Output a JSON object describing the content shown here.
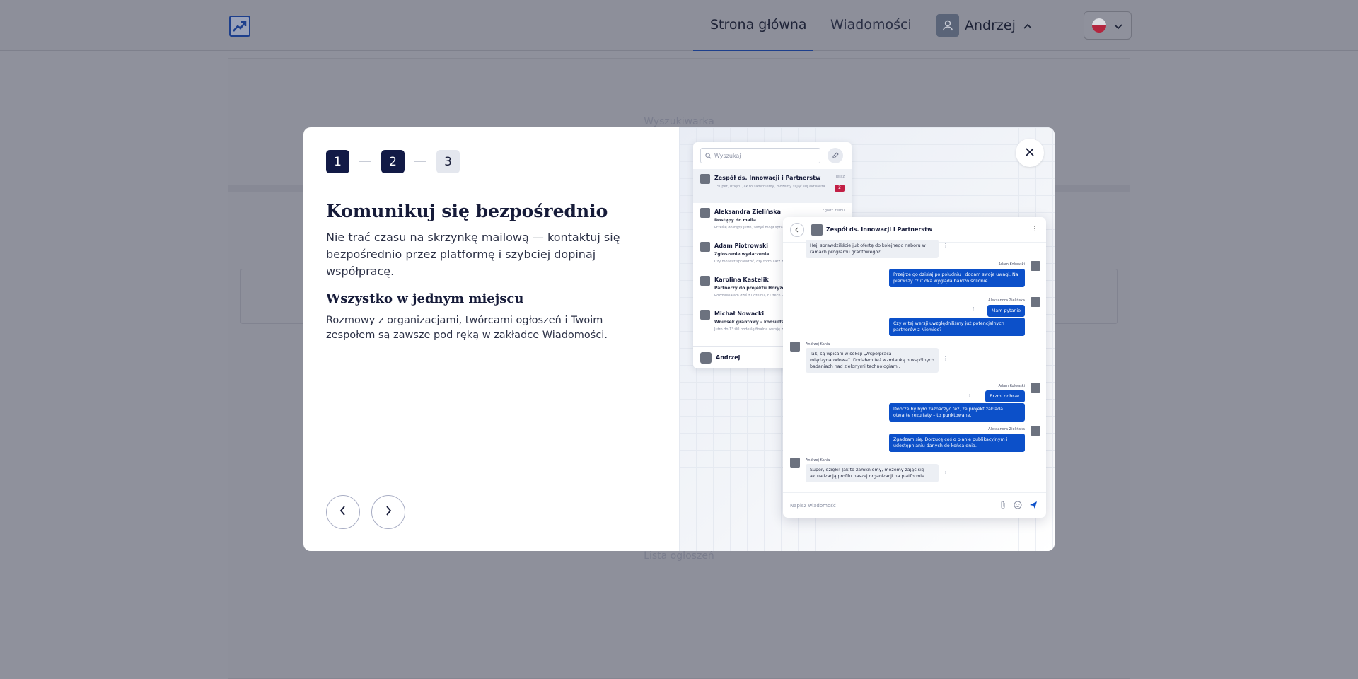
{
  "header": {
    "nav": {
      "home": "Strona główna",
      "messages": "Wiadomości"
    },
    "user": {
      "name": "Andrzej"
    }
  },
  "background": {
    "search_label": "Wyszukiwarka",
    "list_label": "Lista ogłoszeń"
  },
  "modal": {
    "steps": [
      "1",
      "2",
      "3"
    ],
    "current_step": 2,
    "title": "Komunikuj się bezpośrednio",
    "lead": "Nie trać czasu na skrzynkę mailową — kontaktuj się bezpośrednio przez platformę i szybciej dopinaj współpracę.",
    "subtitle": "Wszystko w jednym miejscu",
    "body": "Rozmowy z organizacjami, twórcami ogłoszeń i Twoim zespołem są zawsze pod ręką w zakładce Wiadomości.",
    "illustration": {
      "inbox": {
        "search_placeholder": "Wyszukaj",
        "conversations": [
          {
            "name": "Zespół ds. Innowacji i Partnerstw",
            "time": "Teraz",
            "subject": "",
            "preview": "Super, dzięki! Jak to zamkniemy, możemy zająć się aktualiza...",
            "badge": "2"
          },
          {
            "name": "Aleksandra Zielińska",
            "time": "Zgodz. temu",
            "subject": "Dostępy do maila",
            "preview": "Prześlę dostępy jutro, żebyś mógł sprawdzić...",
            "badge": ""
          },
          {
            "name": "Adam Piotrowski",
            "time": "",
            "subject": "Zgłoszenie wydarzenia",
            "preview": "Czy możesz sprawdzić, czy formularz zgłoszenia...",
            "badge": ""
          },
          {
            "name": "Karolina Kastelik",
            "time": "",
            "subject": "Partnerzy do projektu Horyzont",
            "preview": "Rozmawiałam dziś z uczelnią z Czech – są...",
            "badge": ""
          },
          {
            "name": "Michał Nowacki",
            "time": "",
            "subject": "Wniosek grantowy – konsultacja",
            "preview": "Jutro do 13:00 podeślę finalną wersję z...",
            "badge": ""
          }
        ],
        "current_user": "Andrzej"
      },
      "chat": {
        "title": "Zespół ds. Innowacji i Partnerstw",
        "input_placeholder": "Napisz wiadomość",
        "messages": [
          {
            "side": "in",
            "author": "",
            "text": "Hej, sprawdziliście już ofertę do kolejnego naboru w ramach programu grantowego?",
            "time": "9:12"
          },
          {
            "side": "out",
            "author": "Adam Kolwaski",
            "text": "Przejrzę go dzisiaj po południu i dodam swoje uwagi. Na pierwszy rzut oka wygląda bardzo solidnie.",
            "time": "9:15"
          },
          {
            "side": "out",
            "author": "Aleksandra Zielińska",
            "text": "Mam pytanie",
            "time": "9:20"
          },
          {
            "side": "out",
            "author": "",
            "text": "Czy w tej wersji uwzględniliśmy już potencjalnych partnerów z Niemiec?",
            "time": "9:21"
          },
          {
            "side": "in",
            "author": "Andrzej Kania",
            "text": "Tak, są wpisani w sekcji „Współpraca międzynarodowa”. Dodałem też wzmiankę o wspólnych badaniach nad zielonymi technologiami.",
            "time": "9:43"
          },
          {
            "side": "out",
            "author": "Adam Kolwaski",
            "text": "Brzmi dobrze.",
            "time": "10:11"
          },
          {
            "side": "out",
            "author": "",
            "text": "Dobrze by było zaznaczyć też, że projekt zakłada otwarte rezultaty – to punktowane.",
            "time": "10:11"
          },
          {
            "side": "out",
            "author": "Aleksandra Zielińska",
            "text": "Zgadzam się. Dorzucę coś o planie publikacyjnym i udostępnianiu danych do końca dnia.",
            "time": "10:12"
          },
          {
            "side": "in",
            "author": "Andrzej Kania",
            "text": "Super, dzięki! Jak to zamkniemy, możemy zająć się aktualizacją profilu naszej organizacji na platformie.",
            "time": "10:20"
          }
        ]
      }
    }
  },
  "colors": {
    "accent": "#121a46",
    "brand_blue": "#0c50c9",
    "overlay": "#8f919c",
    "badge": "#c21f45"
  }
}
